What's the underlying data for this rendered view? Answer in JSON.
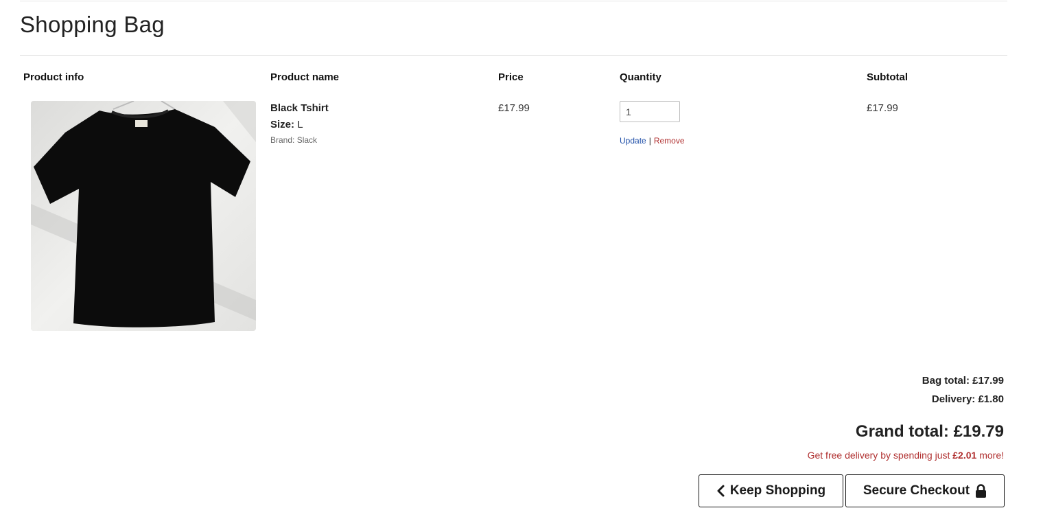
{
  "page": {
    "title": "Shopping Bag"
  },
  "table": {
    "headers": {
      "product_info": "Product info",
      "product_name": "Product name",
      "price": "Price",
      "quantity": "Quantity",
      "subtotal": "Subtotal"
    },
    "rows": [
      {
        "name": "Black Tshirt",
        "size_label": "Size:",
        "size_value": "L",
        "brand": "Brand: Slack",
        "price": "£17.99",
        "quantity": "1",
        "update_label": "Update",
        "separator": "|",
        "remove_label": "Remove",
        "subtotal": "£17.99",
        "image_icon": "black-tshirt-product-photo"
      }
    ]
  },
  "summary": {
    "bag_total": "Bag total: £17.99",
    "delivery": "Delivery: £1.80",
    "grand_total": "Grand total: £19.79",
    "free_delivery_prefix": "Get free delivery by spending just",
    "free_delivery_amount": "£2.01",
    "free_delivery_suffix": "more!"
  },
  "actions": {
    "keep_shopping": "Keep Shopping",
    "keep_shopping_icon": "chevron-left-icon",
    "secure_checkout": "Secure Checkout",
    "secure_checkout_icon": "lock-icon"
  },
  "colors": {
    "link_blue": "#1f4fa8",
    "danger_red": "#b03030",
    "text_dark": "#222222"
  }
}
